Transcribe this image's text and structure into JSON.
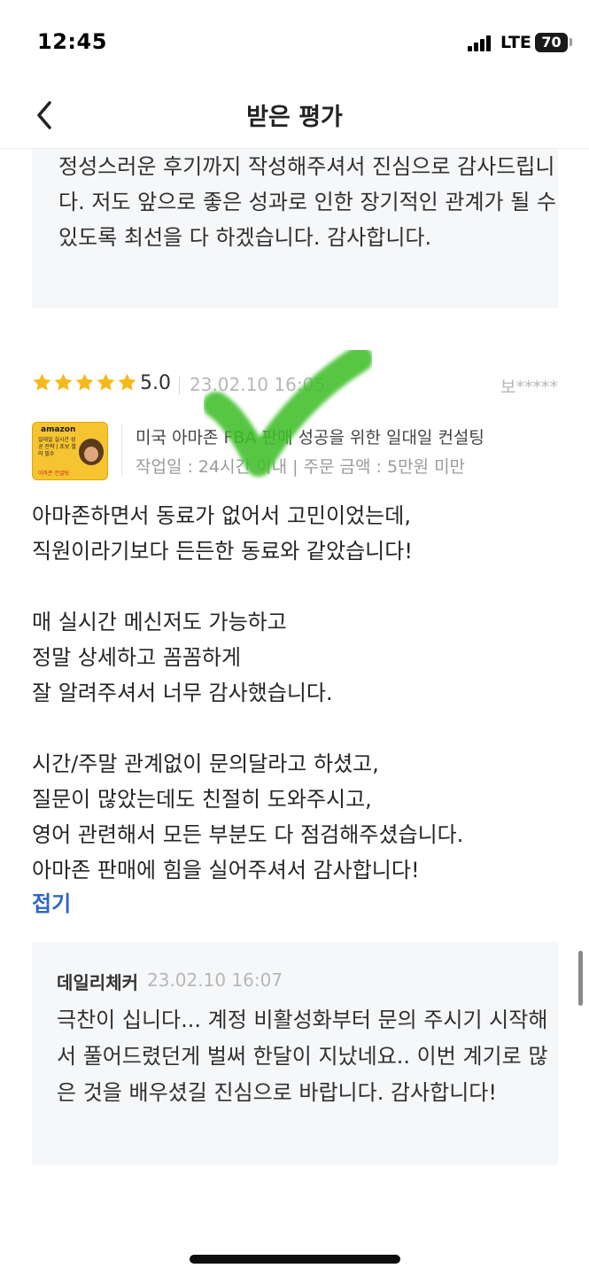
{
  "status_bar": {
    "time": "12:45",
    "network": "LTE",
    "battery": "70"
  },
  "nav": {
    "title": "받은 평가"
  },
  "previous_reply": {
    "text": "정성스러운 후기까지 작성해주셔서 진심으로 감사드립니다. 저도 앞으로 좋은 성과로 인한 장기적인 관계가 될 수 있도록 최선을 다 하겠습니다. 감사합니다."
  },
  "review": {
    "rating": 5,
    "score": "5.0",
    "date": "23.02.10 16:05",
    "reviewer": "보*****",
    "gig": {
      "thumbnail_brand": "amazon",
      "thumbnail_text": "일대일 실시간 성공 전략 | 초보 셀러 필수",
      "thumbnail_sub": "아마존 컨설팅",
      "title": "미국 아마존 FBA 판매 성공을 위한 일대일 컨설팅",
      "meta": "작업일 : 24시간 이내 | 주문 금액 : 5만원 미만"
    },
    "body": [
      "아마존하면서 동료가 없어서 고민이었는데,",
      "직원이라기보다 든든한 동료와 같았습니다!",
      "",
      "매 실시간 메신저도 가능하고",
      "정말 상세하고 꼼꼼하게",
      "잘 알려주셔서 너무 감사했습니다.",
      "",
      "시간/주말 관계없이 문의달라고 하셨고,",
      "질문이 많았는데도 친절히 도와주시고,",
      "영어 관련해서 모든 부분도 다 점검해주셨습니다.",
      "아마존 판매에 힘을 실어주셔서 감사합니다!"
    ],
    "fold_label": "접기"
  },
  "seller_reply": {
    "author": "데일리체커",
    "date": "23.02.10 16:07",
    "text": "극찬이 십니다... 계정 비활성화부터 문의 주시기 시작해서 풀어드렸던게 벌써 한달이 지났네요.. 이번 계기로 많은 것을 배우셨길 진심으로 바랍니다. 감사합니다!"
  },
  "colors": {
    "star": "#f6b91a",
    "link": "#2f66c7",
    "reply_bg": "#f6f7f9",
    "checkmark": "#3fbf2a"
  }
}
